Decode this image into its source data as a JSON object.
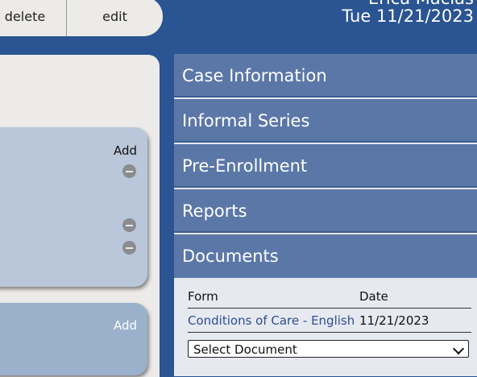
{
  "toolbar": {
    "delete_label": "delete",
    "edit_label": "edit"
  },
  "user": {
    "name": "Erica Macias",
    "date": "Tue 11/21/2023"
  },
  "left": {
    "card1": {
      "add_label": "Add",
      "remove_icons": [
        "minus-circle-icon",
        "minus-circle-icon",
        "minus-circle-icon"
      ]
    },
    "card2": {
      "add_label": "Add"
    }
  },
  "accordion": {
    "sections": [
      {
        "label": "Case Information"
      },
      {
        "label": "Informal Series"
      },
      {
        "label": "Pre-Enrollment"
      },
      {
        "label": "Reports"
      },
      {
        "label": "Documents"
      }
    ]
  },
  "documents": {
    "columns": {
      "form": "Form",
      "date": "Date"
    },
    "rows": [
      {
        "form": "Conditions of Care - English",
        "date": "11/21/2023"
      }
    ],
    "select": {
      "value": "Select Document"
    }
  },
  "colors": {
    "background": "#2a5492",
    "accordion_header": "#5b77a8",
    "link": "#2d4f90",
    "card": "#bac7da"
  }
}
